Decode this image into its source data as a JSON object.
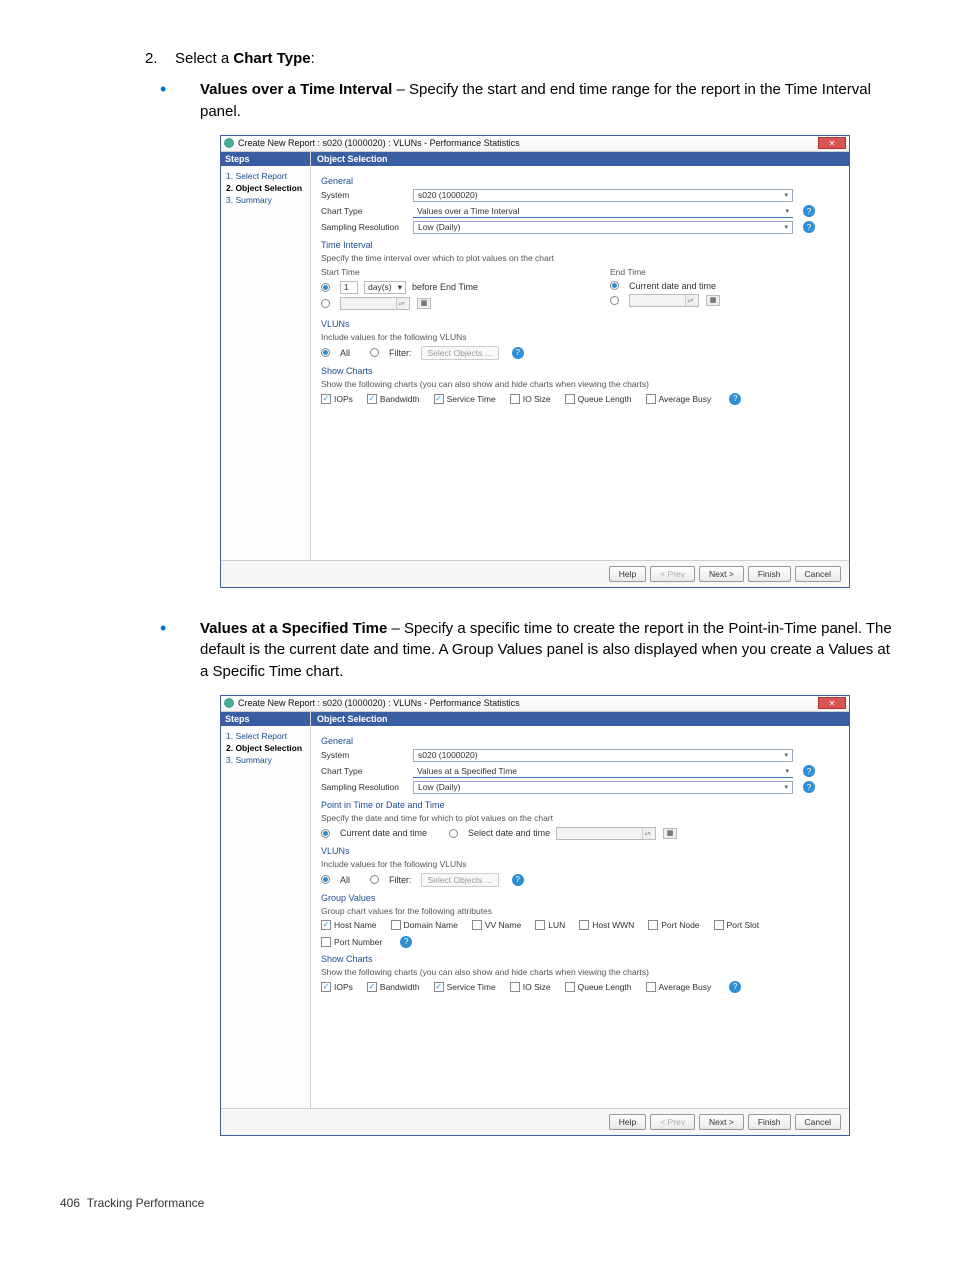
{
  "step": {
    "num": "2.",
    "text_prefix": "Select a ",
    "text_bold": "Chart Type",
    "text_suffix": ":"
  },
  "bullets": [
    {
      "title": "Values over a Time Interval",
      "desc": " – Specify the start and end time range for the report in the Time Interval panel."
    },
    {
      "title": "Values at a Specified Time",
      "desc": " – Specify a specific time to create the report in the Point-in-Time panel. The default is the current date and time. A Group Values panel is also displayed when you create a Values at a Specific Time chart."
    }
  ],
  "dialog": {
    "title": "Create New Report : s020 (1000020) : VLUNs - Performance Statistics",
    "steps_header": "Steps",
    "content_header": "Object Selection",
    "steps": [
      "1. Select Report",
      "2. Object Selection",
      "3. Summary"
    ],
    "sec_general": "General",
    "lbl_system": "System",
    "val_system": "s020 (1000020)",
    "lbl_chart_type": "Chart Type",
    "val_chart_type_a": "Values over a Time Interval",
    "val_chart_type_b": "Values at a Specified Time",
    "lbl_sampling": "Sampling Resolution",
    "val_sampling": "Low (Daily)",
    "sec_time_interval": "Time Interval",
    "time_interval_sub": "Specify the time interval over which to plot values on the chart",
    "lbl_start": "Start Time",
    "lbl_end": "End Time",
    "start_val": "1",
    "start_unit": "day(s)",
    "start_suffix": "before End Time",
    "end_current": "Current date and time",
    "sec_pit": "Point in Time or Date and Time",
    "pit_sub": "Specify the date and time for which to plot values on the chart",
    "pit_current": "Current date and time",
    "pit_select": "Select date and time",
    "sec_vluns": "VLUNs",
    "vluns_sub": "Include values for the following VLUNs",
    "opt_all": "All",
    "opt_filter": "Filter:",
    "select_objects": "Select Objects ...",
    "sec_group": "Group Values",
    "group_sub": "Group chart values for the following attributes",
    "group_opts": [
      "Host Name",
      "Domain Name",
      "VV Name",
      "LUN",
      "Host WWN",
      "Port Node",
      "Port Slot",
      "Port Number"
    ],
    "group_checked": [
      true,
      false,
      false,
      false,
      false,
      false,
      false,
      false
    ],
    "sec_show": "Show Charts",
    "show_sub": "Show the following charts (you can also show and hide charts when viewing the charts)",
    "show_opts": [
      "IOPs",
      "Bandwidth",
      "Service Time",
      "IO Size",
      "Queue Length",
      "Average Busy"
    ],
    "show_checked": [
      true,
      true,
      true,
      false,
      false,
      false
    ],
    "buttons": {
      "help": "Help",
      "prev": "< Prev",
      "next": "Next >",
      "finish": "Finish",
      "cancel": "Cancel"
    }
  },
  "footer": {
    "page": "406",
    "section": "Tracking Performance"
  }
}
